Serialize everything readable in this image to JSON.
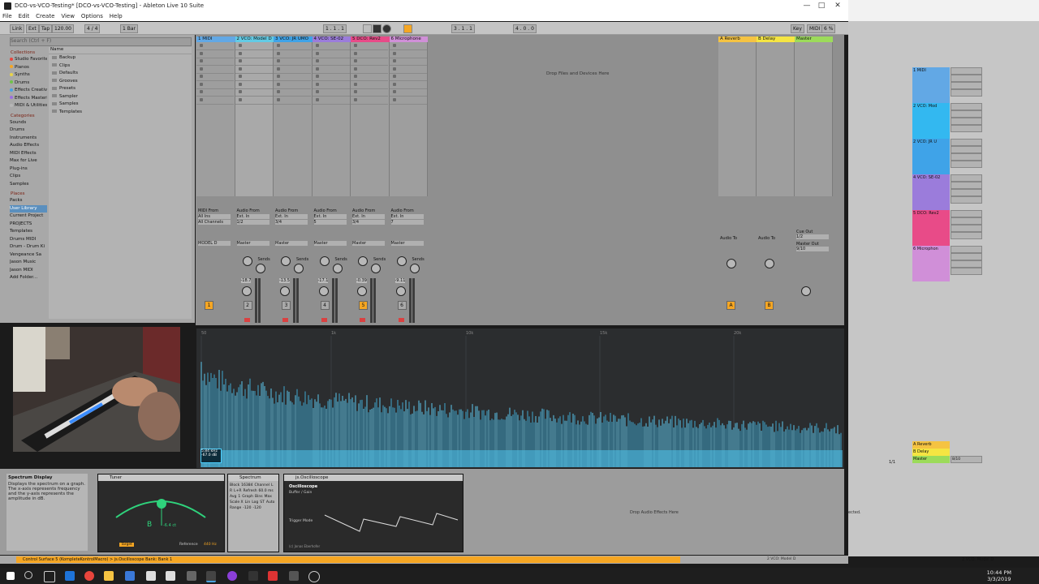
{
  "window": {
    "title": "DCO-vs-VCO-Testing*  [DCO-vs-VCO-Testing] - Ableton Live 10 Suite"
  },
  "menu": [
    "File",
    "Edit",
    "Create",
    "View",
    "Options",
    "Help"
  ],
  "control_bar": {
    "link": "Link",
    "ext": "Ext",
    "tap": "Tap",
    "tempo": "120.00",
    "sig": "4 / 4",
    "quant": "1 Bar",
    "pos": "1 . 1 . 1",
    "pos2": "3 . 1 . 1",
    "pos3": "4 . 0 . 0",
    "key": "Key",
    "midi": "MIDI",
    "cpu": "6 %"
  },
  "browser": {
    "search_placeholder": "Search (Ctrl + F)",
    "collections_title": "Collections",
    "collections": [
      {
        "label": "Studio Favorites",
        "color": "#e8453c"
      },
      {
        "label": "Pianos",
        "color": "#f5a623"
      },
      {
        "label": "Synths",
        "color": "#e9d44a"
      },
      {
        "label": "Drums",
        "color": "#6fc24b"
      },
      {
        "label": "Effects Creative",
        "color": "#4aa3e0"
      },
      {
        "label": "Effects Mastering",
        "color": "#9b6fe0"
      },
      {
        "label": "MIDI & Utilities",
        "color": "#b6b6b6"
      }
    ],
    "categories_title": "Categories",
    "categories": [
      "Sounds",
      "Drums",
      "Instruments",
      "Audio Effects",
      "MIDI Effects",
      "Max for Live",
      "Plug-ins",
      "Clips",
      "Samples"
    ],
    "places_title": "Places",
    "places": [
      "Packs",
      "User Library",
      "Current Project",
      "PROJECTS",
      "Templates",
      "Drums MIDI",
      "Drum - Drum Ki",
      "Vengeance Sa",
      "Jason Music",
      "Jason MIDI",
      "Add Folder..."
    ],
    "name_header": "Name",
    "files": [
      "Backup",
      "Clips",
      "Defaults",
      "Grooves",
      "Presets",
      "Sampler",
      "Samples",
      "Templates"
    ]
  },
  "tracks": [
    {
      "name": "1 MIDI",
      "color": "#62a8e5",
      "num": "1",
      "from": "MIDI From",
      "in": "All Ins",
      "ch": "All Channels",
      "out": "MODEL D"
    },
    {
      "name": "2 VCO: Model D",
      "color": "#62cbe5",
      "num": "2",
      "from": "Audio From",
      "in": "Ext. In",
      "ch": "1/2",
      "out": "Master",
      "vol": "-18.7"
    },
    {
      "name": "3 VCO: JR UMO",
      "color": "#3fa3e8",
      "num": "3",
      "from": "Audio From",
      "in": "Ext. In",
      "ch": "3/4",
      "out": "Master",
      "vol": "-13.5"
    },
    {
      "name": "4 VCO: SE-02",
      "color": "#9b7cdb",
      "num": "4",
      "from": "Audio From",
      "in": "Ext. In",
      "ch": "5",
      "out": "Master",
      "vol": "-17.1"
    },
    {
      "name": "5 DCO: Rev2",
      "color": "#e84b88",
      "num": "5",
      "from": "Audio From",
      "in": "Ext. In",
      "ch": "3/4",
      "out": "Master",
      "vol": "-0.39"
    },
    {
      "name": "6 Microphone",
      "color": "#d08fd8",
      "num": "6",
      "from": "Audio From",
      "in": "Ext. In",
      "ch": "7",
      "out": "Master",
      "vol": "-9.11"
    }
  ],
  "returns": [
    {
      "name": "A Reverb",
      "color": "#f5c342",
      "letter": "A"
    },
    {
      "name": "B Delay",
      "color": "#f5e542",
      "letter": "B"
    }
  ],
  "master": {
    "name": "Master",
    "color": "#9cdb5a",
    "cue": "Cue Out",
    "cue_val": "1/2",
    "out": "Master Out",
    "out_val": "9/10"
  },
  "session_drop": "Drop Files and Devices Here",
  "sends_label": "Sends",
  "audio_to_label": "Audio To",
  "spectrum": {
    "freq_ticks": [
      "50",
      "1k",
      "10k",
      "15k",
      "20k"
    ],
    "readout_line1": "5.84 kHz",
    "readout_line2": "-67.0 dB"
  },
  "devices": {
    "info_title": "Spectrum Display",
    "info_body": "Displays the spectrum on a graph. The x-axis represents frequency and the y-axis represents the amplitude in dB.",
    "tuner_title": "Tuner",
    "tuner_note": "B",
    "tuner_cents": "-6.4 ct",
    "tuner_ref": "Reference",
    "tuner_ref_val": "440 Hz",
    "tuner_target": "Target",
    "spectrum_title": "Spectrum",
    "spectrum_params": [
      "Block",
      "16384",
      "Channel",
      "L",
      "R",
      "L+R",
      "Refresh",
      "60.0 ms",
      "Avg",
      "1",
      "Graph",
      "Bins",
      "Max",
      "Scale X",
      "Lin",
      "Log",
      "ST",
      "Auto",
      "Range",
      "-120",
      "-120"
    ],
    "scope_title": "js.Oscilloscope",
    "scope_sub": "Oscilloscope",
    "scope_sub2": "Buffer / Gain",
    "scope_trigger": "Trigger Mode",
    "scope_author": "(c) Jonas Eberhofer",
    "drop_effects": "Drop Audio Effects Here",
    "ghost_text": "ected."
  },
  "status_message": "Control Surface 5 (KompleteKontrolMacro) > js.Oscilloscope Bank: Bank 1",
  "status_right": "2 VCO: Model D",
  "right_panel": {
    "tracks": [
      {
        "name": "1 MIDI",
        "color": "#62a8e5"
      },
      {
        "name": "2 VCO: Mod",
        "color": "#33b8f0"
      },
      {
        "name": "2 VCO: JR U",
        "color": "#3fa3e8"
      },
      {
        "name": "4 VCO: SE-02",
        "color": "#9b7cdb"
      },
      {
        "name": "5 DCO: Rev2",
        "color": "#e84b88"
      },
      {
        "name": "6 Microphon",
        "color": "#d08fd8"
      }
    ],
    "returns": [
      "A Reverb",
      "B Delay",
      "Master"
    ],
    "master_out": "8/10",
    "page": "1/1",
    "status": "2 VCO: Model D"
  },
  "taskbar": {
    "time": "10:44 PM",
    "date": "3/3/2019"
  }
}
